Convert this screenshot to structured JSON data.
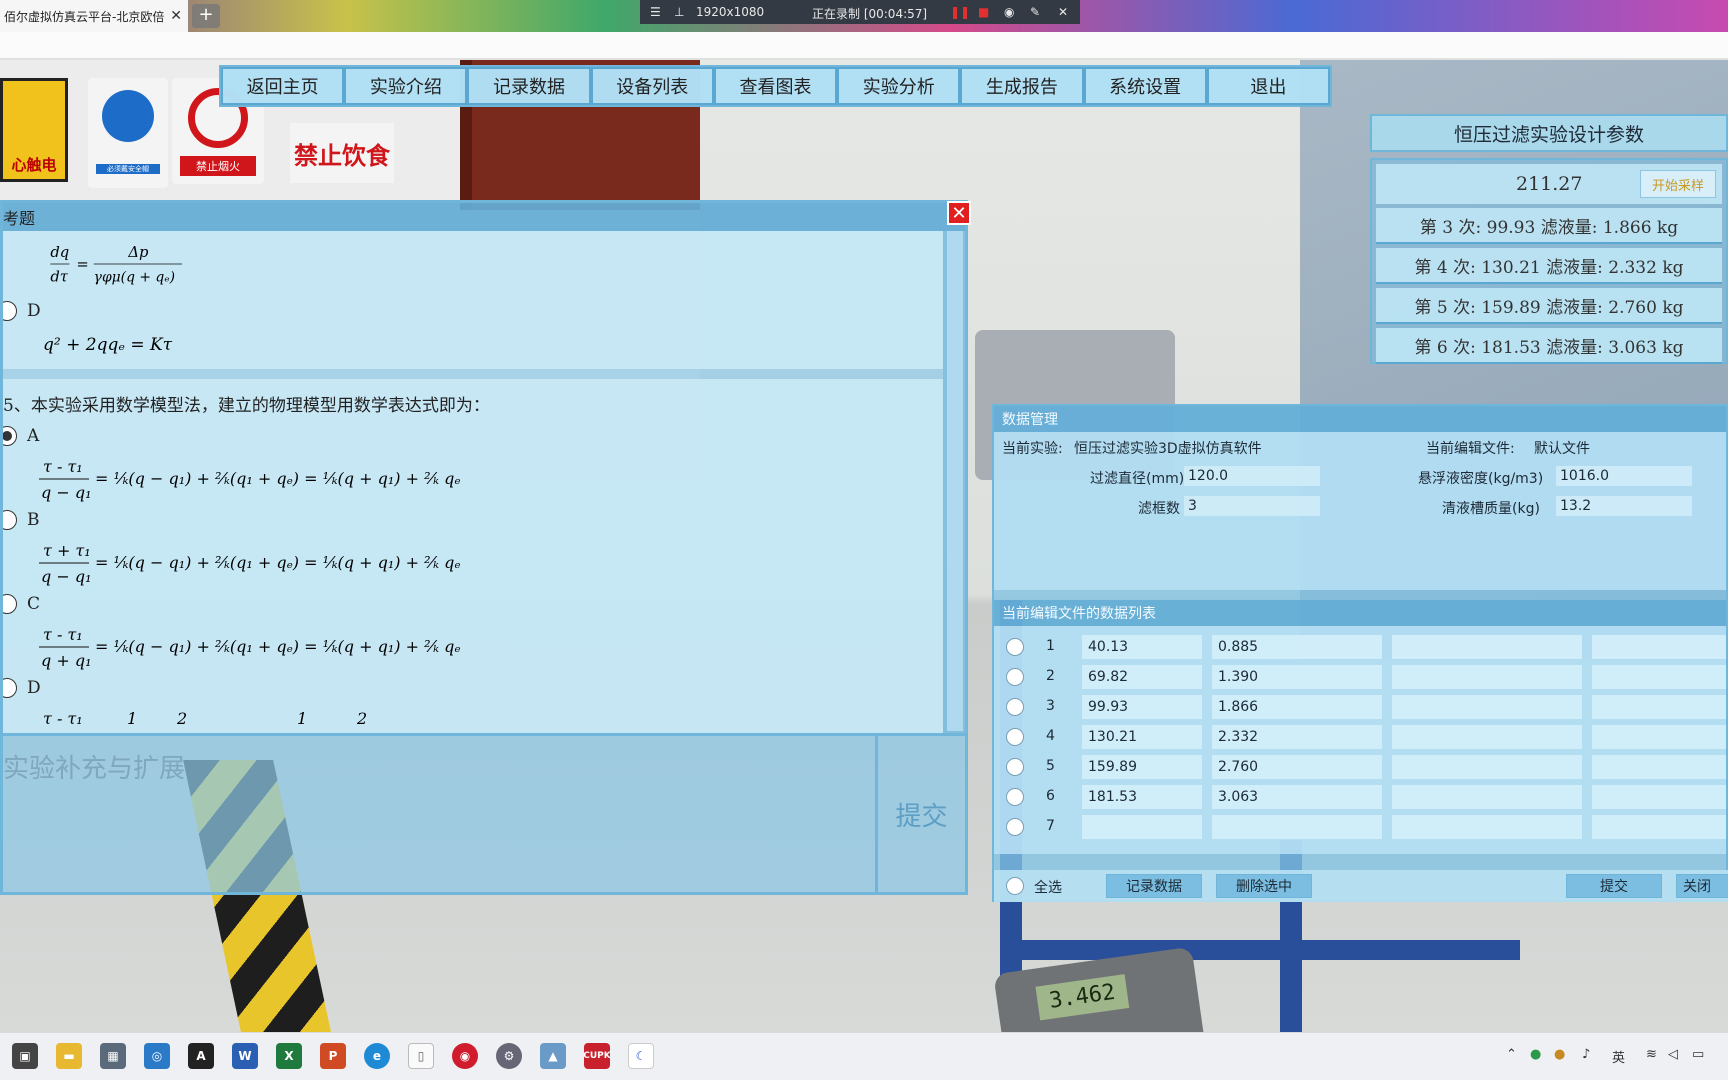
{
  "browser": {
    "tab_title": "佰尔虚拟仿真云平台-北京欧倍",
    "tab_close": "✕",
    "new_tab": "+",
    "recorder": {
      "menu": "☰",
      "resolution": "1920x1080",
      "status": "正在录制 [00:04:57]"
    }
  },
  "signs": {
    "electric": "心触电",
    "helmet": "必须戴安全帽",
    "nofire": "禁止烟火",
    "nofood": "禁止饮食"
  },
  "nav": [
    "返回主页",
    "实验介绍",
    "记录数据",
    "设备列表",
    "查看图表",
    "实验分析",
    "生成报告",
    "系统设置",
    "退出"
  ],
  "params": {
    "title": "恒压过滤实验设计参数",
    "current_value": "211.27",
    "start_button": "开始采样",
    "rows": [
      "第 3 次: 99.93   滤液量: 1.866 kg",
      "第 4 次: 130.21   滤液量: 2.332 kg",
      "第 5 次: 159.89   滤液量: 2.760 kg",
      "第 6 次: 181.53   滤液量: 3.063 kg"
    ]
  },
  "question_panel": {
    "header": "考题",
    "close": "✕",
    "prev_opt_c": "C",
    "prev_opt_d": "D",
    "q5_text": "5、本实验采用数学模型法，建立的物理模型用数学表达式即为：",
    "options": [
      "A",
      "B",
      "C",
      "D"
    ],
    "supplement": "实验补充与扩展",
    "submit": "提交"
  },
  "data_mgmt": {
    "title": "数据管理",
    "current_exp_label": "当前实验:",
    "current_exp_value": "恒压过滤实验3D虚拟仿真软件",
    "current_file_label": "当前编辑文件:",
    "current_file_value": "默认文件",
    "filter_diameter_label": "过滤直径(mm)",
    "filter_diameter_value": "120.0",
    "frames_label": "滤框数",
    "frames_value": "3",
    "density_label": "悬浮液密度(kg/m3)",
    "density_value": "1016.0",
    "tank_mass_label": "清液槽质量(kg)",
    "tank_mass_value": "13.2",
    "list_title": "当前编辑文件的数据列表",
    "rows": [
      {
        "idx": "1",
        "a": "40.13",
        "b": "0.885"
      },
      {
        "idx": "2",
        "a": "69.82",
        "b": "1.390"
      },
      {
        "idx": "3",
        "a": "99.93",
        "b": "1.866"
      },
      {
        "idx": "4",
        "a": "130.21",
        "b": "2.332"
      },
      {
        "idx": "5",
        "a": "159.89",
        "b": "2.760"
      },
      {
        "idx": "6",
        "a": "181.53",
        "b": "3.063"
      },
      {
        "idx": "7",
        "a": "",
        "b": ""
      }
    ],
    "select_all": "全选",
    "record_btn": "记录数据",
    "delete_btn": "删除选中",
    "submit_btn": "提交",
    "close_btn": "关闭"
  },
  "scale_display": "3.462",
  "tray": {
    "ime": "英"
  }
}
